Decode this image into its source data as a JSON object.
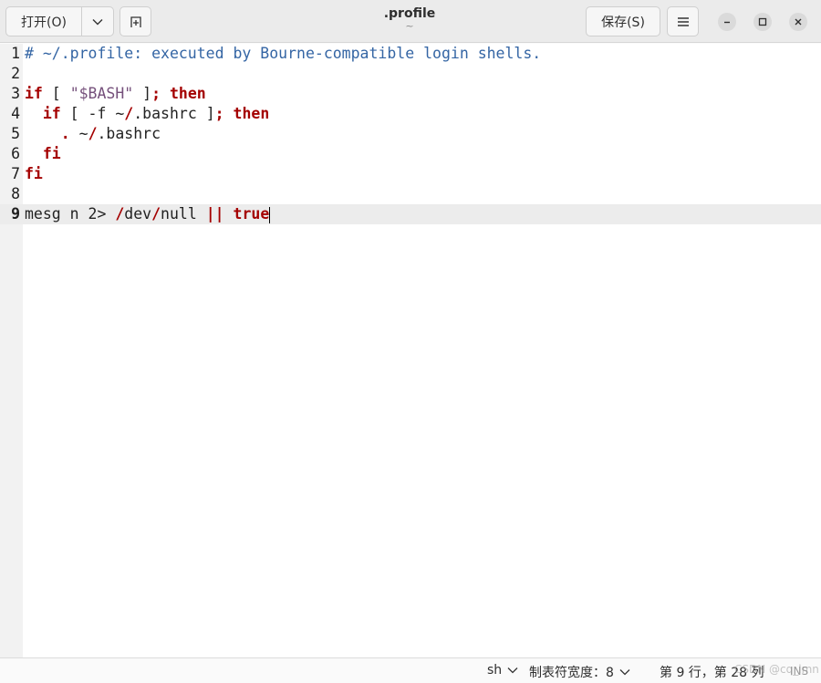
{
  "header": {
    "open_label": "打开(O)",
    "title": ".profile",
    "subtitle": "~",
    "save_label": "保存(S)"
  },
  "editor": {
    "current_line": 9,
    "lines": [
      {
        "num": "1",
        "tokens": [
          {
            "t": "# ~/.profile: executed by Bourne-compatible login shells.",
            "c": "comment"
          }
        ]
      },
      {
        "num": "2",
        "tokens": []
      },
      {
        "num": "3",
        "tokens": [
          {
            "t": "if",
            "c": "kw"
          },
          {
            "t": " [ ",
            "c": ""
          },
          {
            "t": "\"$BASH\"",
            "c": "str"
          },
          {
            "t": " ]",
            "c": ""
          },
          {
            "t": ";",
            "c": "op"
          },
          {
            "t": " ",
            "c": ""
          },
          {
            "t": "then",
            "c": "kw"
          }
        ]
      },
      {
        "num": "4",
        "tokens": [
          {
            "t": "  ",
            "c": ""
          },
          {
            "t": "if",
            "c": "kw"
          },
          {
            "t": " [ -f ~",
            "c": ""
          },
          {
            "t": "/",
            "c": "op"
          },
          {
            "t": ".bashrc ]",
            "c": ""
          },
          {
            "t": ";",
            "c": "op"
          },
          {
            "t": " ",
            "c": ""
          },
          {
            "t": "then",
            "c": "kw"
          }
        ]
      },
      {
        "num": "5",
        "tokens": [
          {
            "t": "    ",
            "c": ""
          },
          {
            "t": ".",
            "c": "op"
          },
          {
            "t": " ~",
            "c": ""
          },
          {
            "t": "/",
            "c": "op"
          },
          {
            "t": ".bashrc",
            "c": ""
          }
        ]
      },
      {
        "num": "6",
        "tokens": [
          {
            "t": "  ",
            "c": ""
          },
          {
            "t": "fi",
            "c": "kw"
          }
        ]
      },
      {
        "num": "7",
        "tokens": [
          {
            "t": "fi",
            "c": "kw"
          }
        ]
      },
      {
        "num": "8",
        "tokens": []
      },
      {
        "num": "9",
        "tokens": [
          {
            "t": "mesg n 2> ",
            "c": ""
          },
          {
            "t": "/",
            "c": "op"
          },
          {
            "t": "dev",
            "c": ""
          },
          {
            "t": "/",
            "c": "op"
          },
          {
            "t": "null ",
            "c": ""
          },
          {
            "t": "||",
            "c": "op"
          },
          {
            "t": " ",
            "c": ""
          },
          {
            "t": "true",
            "c": "kw"
          }
        ]
      }
    ]
  },
  "statusbar": {
    "language": "sh",
    "tab_width": "制表符宽度：8",
    "position": "第 9 行，第 28 列",
    "mode": "INS"
  },
  "watermark": "CSDN @cq_lmn",
  "colors": {
    "comment": "#3465a4",
    "keyword": "#a40000",
    "string": "#75507b",
    "current_line": "#ececec"
  }
}
